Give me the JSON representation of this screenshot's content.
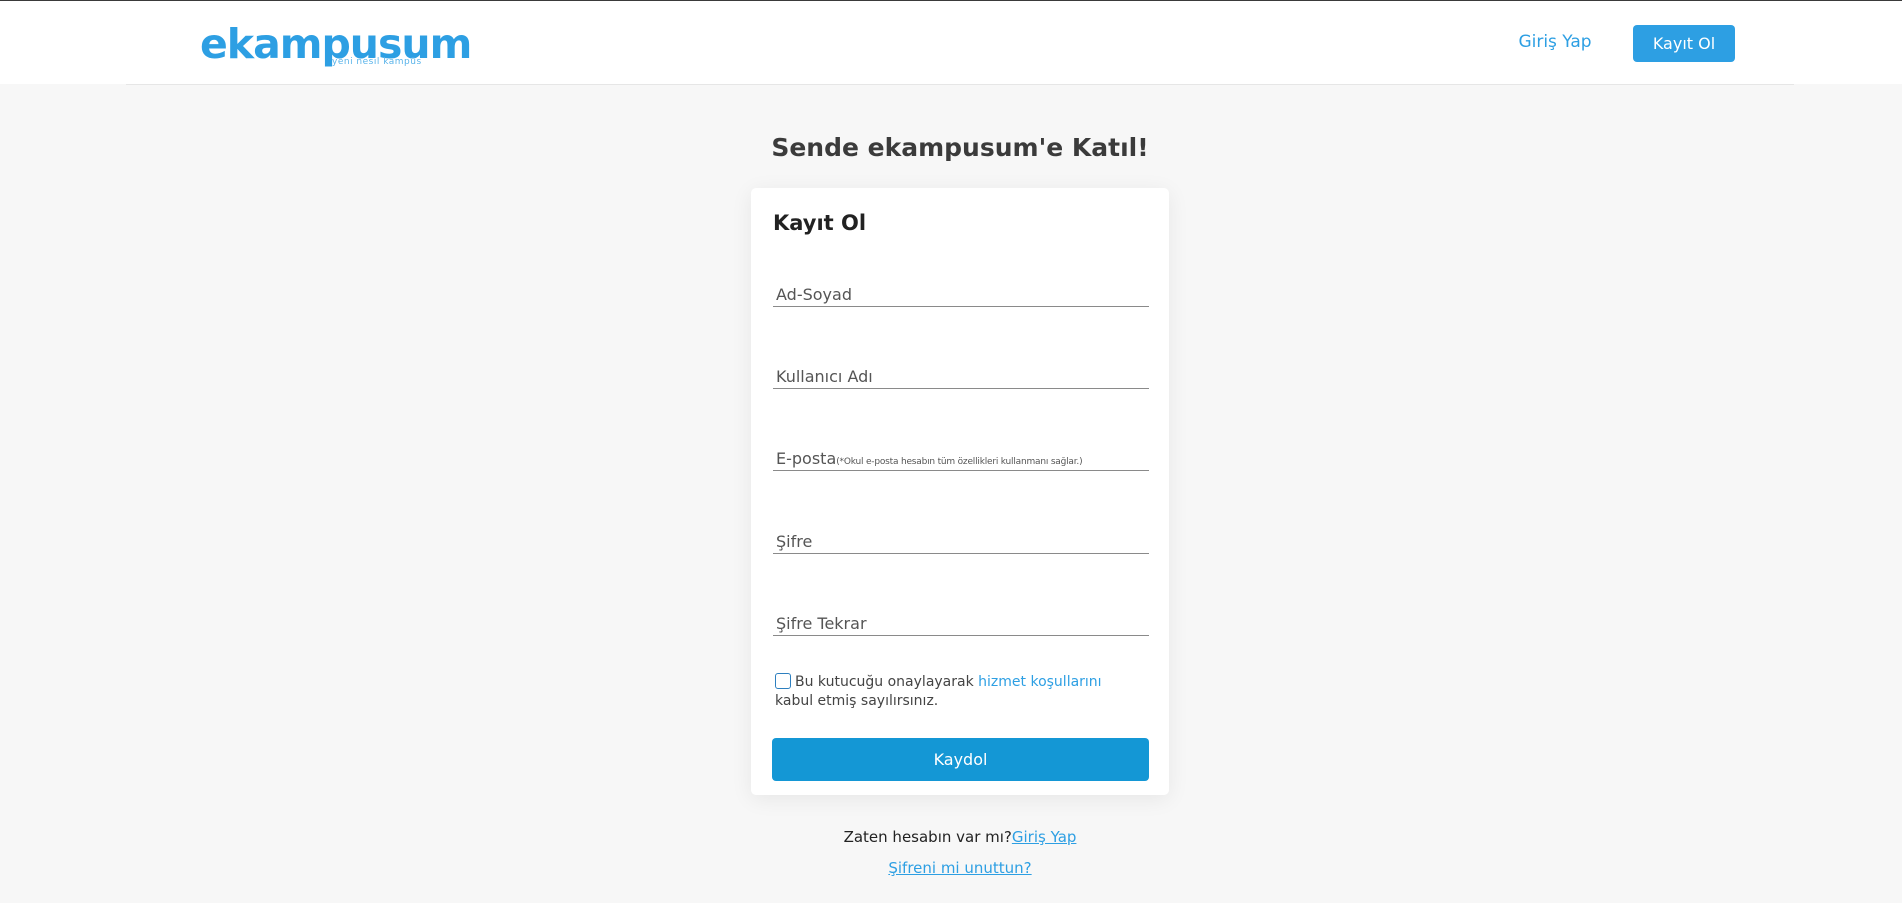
{
  "header": {
    "logo_text": "ekampusum",
    "logo_tagline": "yeni nesil kampüs",
    "nav_login": "Giriş Yap",
    "nav_register": "Kayıt Ol"
  },
  "page": {
    "heading": "Sende ekampusum'e Katıl!"
  },
  "form": {
    "title": "Kayıt Ol",
    "fields": [
      {
        "label": "Ad-Soyad",
        "note": ""
      },
      {
        "label": "Kullanıcı Adı",
        "note": ""
      },
      {
        "label": "E-posta",
        "note": "(*Okul e-posta hesabın tüm özellikleri kullanmanı sağlar.)"
      },
      {
        "label": "Şifre",
        "note": ""
      },
      {
        "label": "Şifre Tekrar",
        "note": ""
      }
    ],
    "terms_prefix": "Bu kutucuğu onaylayarak",
    "terms_link": "hizmet koşullarını",
    "terms_suffix": "kabul etmiş sayılırsınız.",
    "terms_checked": false,
    "submit": "Kaydol"
  },
  "footer": {
    "have_account": "Zaten hesabın var mı?",
    "login_link": "Giriş Yap",
    "forgot_link": "Şifreni mi unuttun?"
  },
  "colors": {
    "brand": "#2d9fe3",
    "submit": "#1497d5",
    "background": "#f7f7f7"
  }
}
